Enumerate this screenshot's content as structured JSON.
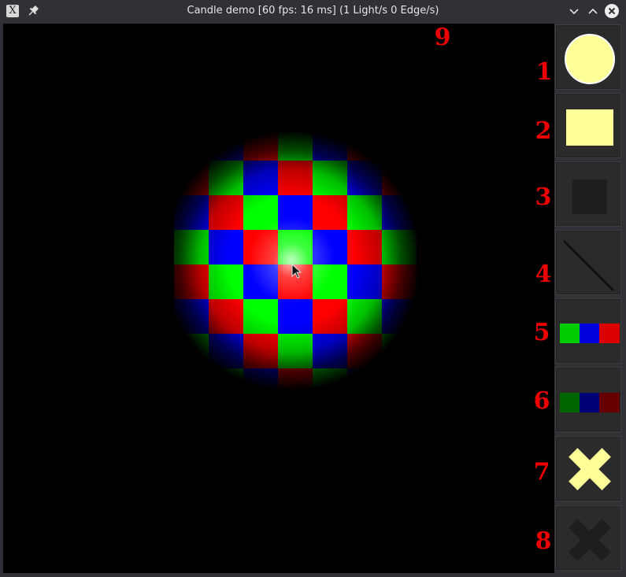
{
  "window": {
    "title": "Candle demo [60 fps: 16 ms] (1 Light/s 0 Edge/s)",
    "app_icon_glyph": "X"
  },
  "titlebar_icons": [
    "app-icon",
    "pin-icon",
    "chevron-down-icon",
    "chevron-up-icon",
    "close-icon"
  ],
  "canvas": {
    "background": "#000000",
    "checker_colors": [
      "#00ff00",
      "#0000ff",
      "#ff0000"
    ],
    "light_color": "#ffffff"
  },
  "annotations": {
    "canvas_label": "9"
  },
  "toolbar": {
    "tools": [
      {
        "number": "1",
        "icon": "light-circle-icon",
        "color": "#ffff99"
      },
      {
        "number": "2",
        "icon": "light-rectangle-icon",
        "color": "#ffff99"
      },
      {
        "number": "3",
        "icon": "dark-square-icon",
        "color": "#1e1e1e"
      },
      {
        "number": "4",
        "icon": "line-edge-icon",
        "color": "#111111"
      },
      {
        "number": "5",
        "icon": "bright-rgb-checker-icon",
        "colors": [
          "#00cc00",
          "#0000dd",
          "#dd0000"
        ]
      },
      {
        "number": "6",
        "icon": "dark-rgb-checker-icon",
        "colors": [
          "#006600",
          "#000077",
          "#660000"
        ]
      },
      {
        "number": "7",
        "icon": "clear-lights-icon",
        "color": "#ffff99"
      },
      {
        "number": "8",
        "icon": "clear-all-icon",
        "color": "#1e1e1e"
      }
    ]
  }
}
